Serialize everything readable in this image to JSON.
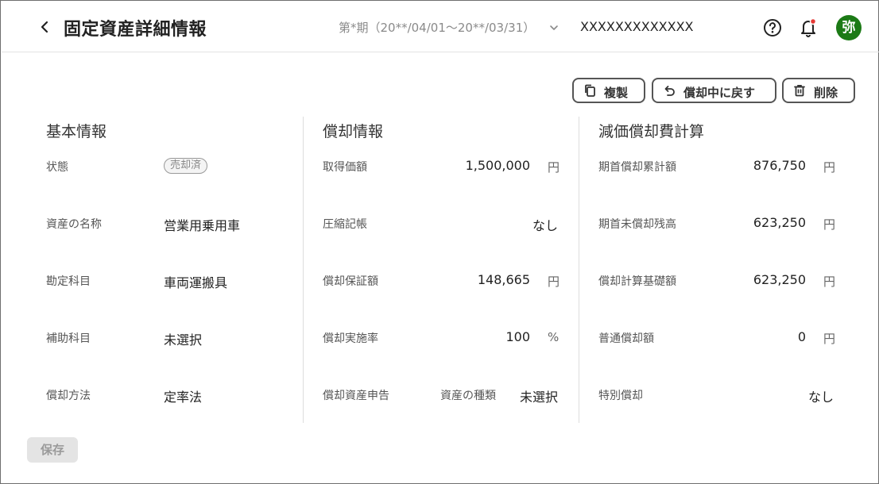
{
  "header": {
    "title": "固定資産詳細情報",
    "period": "第*期（20**/04/01〜20**/03/31）",
    "company": "XXXXXXXXXXXXX",
    "avatar_text": "弥",
    "notification_dot_color": "#e53935",
    "avatar_color": "#1c7a16"
  },
  "actions": {
    "copy_label": "複製",
    "revert_label": "償却中に戻す",
    "delete_label": "削除"
  },
  "basic": {
    "title": "基本情報",
    "status_label": "状態",
    "status_value": "売却済",
    "name_label": "資産の名称",
    "name_value": "営業用乗用車",
    "account_label": "勘定科目",
    "account_value": "車両運搬具",
    "sub_account_label": "補助科目",
    "sub_account_value": "未選択",
    "method_label": "償却方法",
    "method_value": "定率法"
  },
  "depreciation": {
    "title": "償却情報",
    "acq_label": "取得価額",
    "acq_value": "1,500,000",
    "acq_unit": "円",
    "compress_label": "圧縮記帳",
    "compress_value": "なし",
    "guarantee_label": "償却保証額",
    "guarantee_value": "148,665",
    "guarantee_unit": "円",
    "rate_label": "償却実施率",
    "rate_value": "100",
    "rate_unit": "%",
    "declare_label": "償却資産申告",
    "kind_label": "資産の種類",
    "kind_value": "未選択"
  },
  "calc": {
    "title": "減価償却費計算",
    "accum_label": "期首償却累計額",
    "accum_value": "876,750",
    "accum_unit": "円",
    "remain_label": "期首未償却残高",
    "remain_value": "623,250",
    "remain_unit": "円",
    "base_label": "償却計算基礎額",
    "base_value": "623,250",
    "base_unit": "円",
    "normal_label": "普通償却額",
    "normal_value": "0",
    "normal_unit": "円",
    "special_label": "特別償却",
    "special_value": "なし"
  },
  "footer": {
    "save_label": "保存"
  }
}
